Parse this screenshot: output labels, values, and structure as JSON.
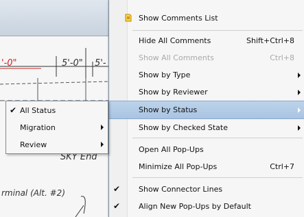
{
  "background": {
    "dims": [
      "'-0\"",
      "5'-0\"",
      "5'-"
    ],
    "label_1": "SKY  End",
    "label_2": "rminal (Alt. #2)"
  },
  "menu": {
    "items": [
      {
        "label": "Show Comments List",
        "shortcut": "",
        "icon": "comments-list-icon",
        "checked": false,
        "disabled": false,
        "submenu": false
      },
      {
        "label": "Hide All Comments",
        "shortcut": "Shift+Ctrl+8",
        "checked": false,
        "disabled": false,
        "submenu": false
      },
      {
        "label": "Show All Comments",
        "shortcut": "Ctrl+8",
        "checked": false,
        "disabled": true,
        "submenu": false
      },
      {
        "label": "Show by Type",
        "shortcut": "",
        "checked": false,
        "disabled": false,
        "submenu": true
      },
      {
        "label": "Show by Reviewer",
        "shortcut": "",
        "checked": false,
        "disabled": false,
        "submenu": true
      },
      {
        "label": "Show by Status",
        "shortcut": "",
        "checked": false,
        "disabled": false,
        "submenu": true,
        "highlighted": true
      },
      {
        "label": "Show by Checked State",
        "shortcut": "",
        "checked": false,
        "disabled": false,
        "submenu": true
      },
      {
        "label": "Open All Pop-Ups",
        "shortcut": "",
        "checked": false,
        "disabled": false,
        "submenu": false
      },
      {
        "label": "Minimize All Pop-Ups",
        "shortcut": "Ctrl+7",
        "checked": false,
        "disabled": false,
        "submenu": false
      },
      {
        "label": "Show Connector Lines",
        "shortcut": "",
        "checked": true,
        "disabled": false,
        "submenu": false
      },
      {
        "label": "Align New Pop-Ups by Default",
        "shortcut": "",
        "checked": true,
        "disabled": false,
        "submenu": false
      }
    ]
  },
  "submenu": {
    "items": [
      {
        "label": "All Status",
        "checked": true,
        "submenu": false
      },
      {
        "label": "Migration",
        "checked": false,
        "submenu": true
      },
      {
        "label": "Review",
        "checked": false,
        "submenu": true
      }
    ]
  },
  "icons": {
    "check": "✔"
  },
  "colors": {
    "highlight": "#a9c4e2",
    "disabled_text": "#a9a9a9",
    "dim_red": "#cc2222"
  }
}
